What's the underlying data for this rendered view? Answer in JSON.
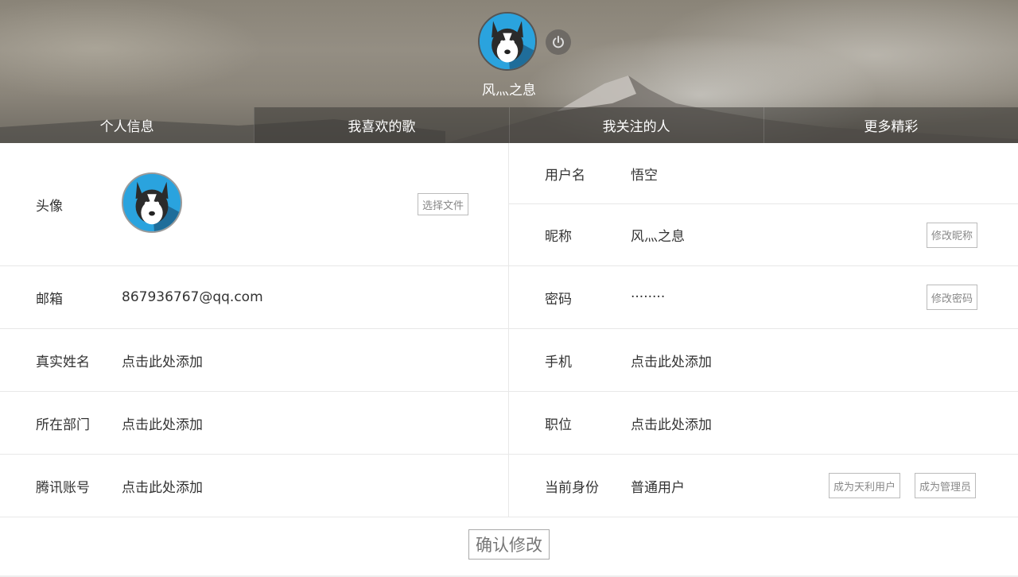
{
  "header": {
    "nickname": "风灬之息",
    "tabs": [
      {
        "label": "个人信息"
      },
      {
        "label": "我喜欢的歌"
      },
      {
        "label": "我关注的人"
      },
      {
        "label": "更多精彩"
      }
    ],
    "active_tab": 0
  },
  "form": {
    "avatar": {
      "label": "头像",
      "button": "选择文件"
    },
    "username": {
      "label": "用户名",
      "value": "悟空"
    },
    "nickname": {
      "label": "昵称",
      "value": "风灬之息",
      "button": "修改昵称"
    },
    "email": {
      "label": "邮箱",
      "value": "867936767@qq.com"
    },
    "password": {
      "label": "密码",
      "value": "········",
      "button": "修改密码"
    },
    "real_name": {
      "label": "真实姓名",
      "value": "点击此处添加"
    },
    "phone": {
      "label": "手机",
      "value": "点击此处添加"
    },
    "department": {
      "label": "所在部门",
      "value": "点击此处添加"
    },
    "position": {
      "label": "职位",
      "value": "点击此处添加"
    },
    "tencent_account": {
      "label": "腾讯账号",
      "value": "点击此处添加"
    },
    "identity": {
      "label": "当前身份",
      "value": "普通用户",
      "button_vip": "成为天利用户",
      "button_admin": "成为管理员"
    }
  },
  "confirm_label": "确认修改",
  "colors": {
    "avatar_bg": "#2aa3de",
    "border": "#e8e8e8"
  },
  "icons": {
    "power": "power-icon",
    "avatar": "husky-avatar-icon"
  }
}
